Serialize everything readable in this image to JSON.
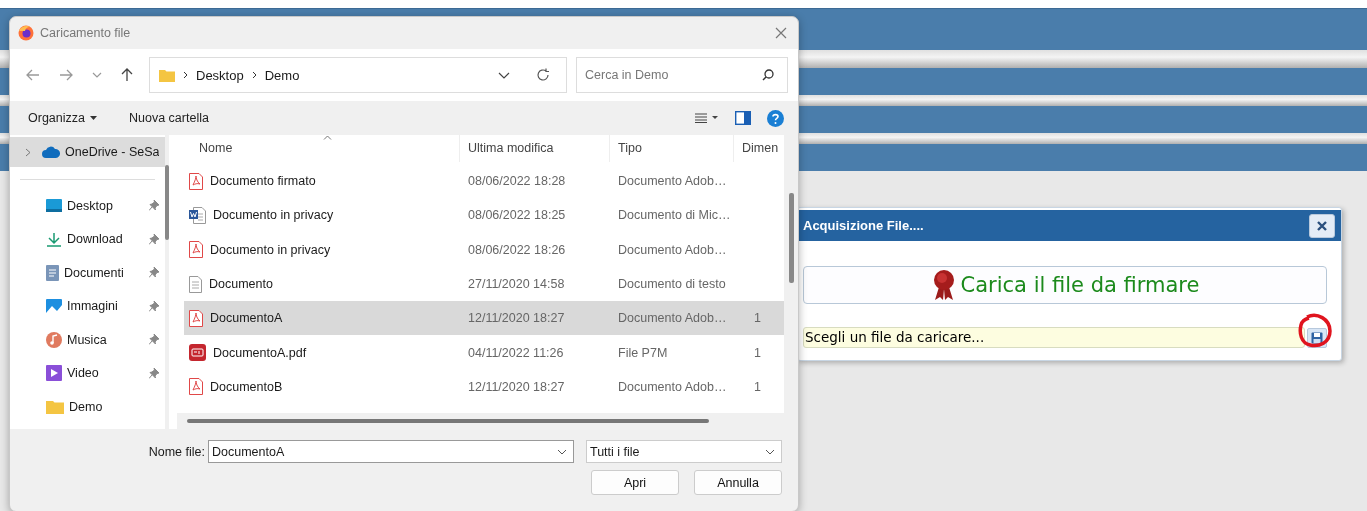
{
  "dialog": {
    "title": "Caricamento file",
    "breadcrumb": [
      "Desktop",
      "Demo"
    ],
    "search": {
      "placeholder": "Cerca in Demo"
    },
    "toolbar": [
      "Organizza",
      "Nuova cartella"
    ],
    "sidebar": {
      "items": [
        {
          "label": "OneDrive - SeSa",
          "kind": "cloud",
          "selected": true,
          "pinned": false
        },
        {
          "label": "Desktop",
          "kind": "desktop",
          "selected": false,
          "pinned": true
        },
        {
          "label": "Download",
          "kind": "download",
          "selected": false,
          "pinned": true
        },
        {
          "label": "Documenti",
          "kind": "documents",
          "selected": false,
          "pinned": true
        },
        {
          "label": "Immagini",
          "kind": "pictures",
          "selected": false,
          "pinned": true
        },
        {
          "label": "Musica",
          "kind": "music",
          "selected": false,
          "pinned": true
        },
        {
          "label": "Video",
          "kind": "video",
          "selected": false,
          "pinned": true
        },
        {
          "label": "Demo",
          "kind": "folder",
          "selected": false,
          "pinned": false
        }
      ]
    },
    "table": {
      "columns": [
        "Nome",
        "Ultima modifica",
        "Tipo",
        "Dimen"
      ],
      "rows": [
        {
          "name": "Documento firmato",
          "kind": "pdf",
          "modified": "08/06/2022 18:28",
          "type": "Documento Adob…",
          "size": "",
          "selected": false
        },
        {
          "name": "Documento in privacy",
          "kind": "word",
          "modified": "08/06/2022 18:25",
          "type": "Documento di Mic…",
          "size": "",
          "selected": false
        },
        {
          "name": "Documento in privacy",
          "kind": "pdf",
          "modified": "08/06/2022 18:26",
          "type": "Documento Adob…",
          "size": "",
          "selected": false
        },
        {
          "name": "Documento",
          "kind": "text",
          "modified": "27/11/2020 14:58",
          "type": "Documento di testo",
          "size": "",
          "selected": false
        },
        {
          "name": "DocumentoA",
          "kind": "pdf",
          "modified": "12/11/2020 18:27",
          "type": "Documento Adob…",
          "size": "1",
          "selected": true
        },
        {
          "name": "DocumentoA.pdf",
          "kind": "p7m",
          "modified": "04/11/2022 11:26",
          "type": "File P7M",
          "size": "1",
          "selected": false
        },
        {
          "name": "DocumentoB",
          "kind": "pdf",
          "modified": "12/11/2020 18:27",
          "type": "Documento Adob…",
          "size": "1",
          "selected": false
        }
      ]
    },
    "filename_label": "Nome file:",
    "filename": "DocumentoA",
    "filter": "Tutti i file",
    "buttons": [
      "Apri",
      "Annulla"
    ]
  },
  "panel": {
    "title": "Acquisizione File....",
    "upload_button": "Carica il file da firmare",
    "file_field": {
      "value": "Scegli un file da caricare...",
      "circled": true
    }
  }
}
